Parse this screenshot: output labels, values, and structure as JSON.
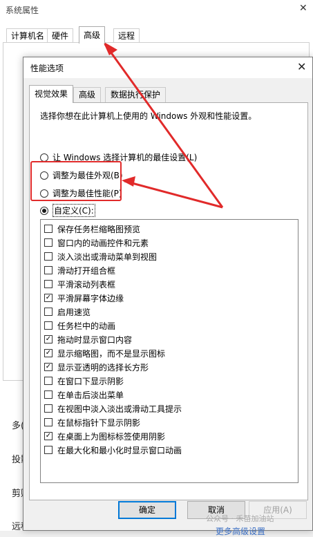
{
  "system_properties": {
    "title": "系统属性",
    "close": "✕",
    "tabs": [
      "计算机名",
      "硬件",
      "高级",
      "远程"
    ],
    "active_tab": "高级",
    "side_fragments": [
      "多(",
      "投影",
      "剪贴",
      "远程"
    ],
    "apply_button": "应用(A)"
  },
  "performance_options": {
    "title": "性能选项",
    "close": "✕",
    "tabs": [
      "视觉效果",
      "高级",
      "数据执行保护"
    ],
    "active_tab": "视觉效果",
    "description": "选择你想在此计算机上使用的 Windows 外观和性能设置。",
    "radios": [
      {
        "label": "让 Windows 选择计算机的最佳设置(L)",
        "selected": false
      },
      {
        "label": "调整为最佳外观(B)",
        "selected": false
      },
      {
        "label": "调整为最佳性能(P)",
        "selected": false
      },
      {
        "label": "自定义(C):",
        "selected": true
      }
    ],
    "effects": [
      {
        "label": "保存任务栏缩略图预览",
        "checked": false
      },
      {
        "label": "窗口内的动画控件和元素",
        "checked": false
      },
      {
        "label": "淡入淡出或滑动菜单到视图",
        "checked": false
      },
      {
        "label": "滑动打开组合框",
        "checked": false
      },
      {
        "label": "平滑滚动列表框",
        "checked": false
      },
      {
        "label": "平滑屏幕字体边缘",
        "checked": true
      },
      {
        "label": "启用速览",
        "checked": false
      },
      {
        "label": "任务栏中的动画",
        "checked": false
      },
      {
        "label": "拖动时显示窗口内容",
        "checked": true
      },
      {
        "label": "显示缩略图，而不是显示图标",
        "checked": true
      },
      {
        "label": "显示亚透明的选择长方形",
        "checked": true
      },
      {
        "label": "在窗口下显示阴影",
        "checked": false
      },
      {
        "label": "在单击后淡出菜单",
        "checked": false
      },
      {
        "label": "在视图中淡入淡出或滑动工具提示",
        "checked": false
      },
      {
        "label": "在鼠标指针下显示阴影",
        "checked": false
      },
      {
        "label": "在桌面上为图标标签使用阴影",
        "checked": true
      },
      {
        "label": "在最大化和最小化时显示窗口动画",
        "checked": false
      }
    ],
    "buttons": {
      "ok": "确定",
      "cancel": "取消",
      "apply": "应用(A)"
    }
  },
  "overlay": {
    "watermark": "公众号 · 禾苗加油站",
    "bottom_link": "更多高级设置"
  },
  "colors": {
    "annotation": "#e12a2a",
    "accent": "#0078d7"
  }
}
